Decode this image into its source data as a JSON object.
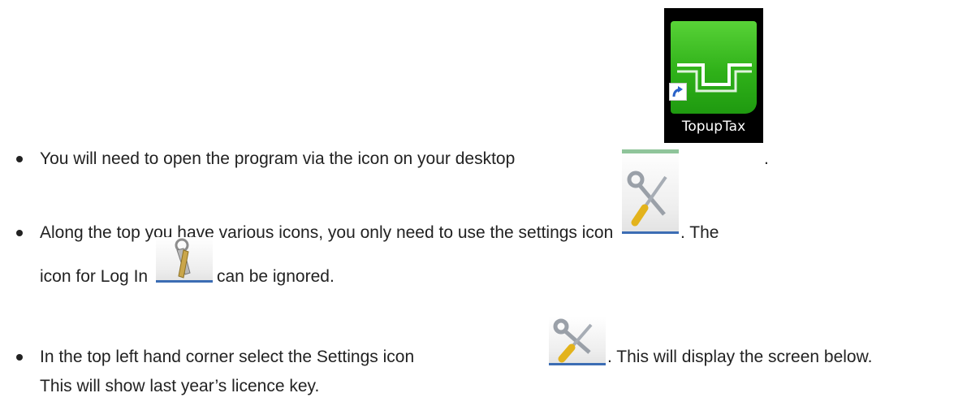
{
  "bullets": [
    {
      "text": "You will need to open the program via the icon on your desktop",
      "trailing": "."
    },
    {
      "text": "Along the top you have various icons, you only need to use the settings icon",
      "trailing": ". The",
      "continuation_before": "icon for Log In",
      "continuation_after": "can be ignored."
    },
    {
      "text": "In the top left hand corner select the Settings icon",
      "trailing": ". This will display the screen below.",
      "continuation": "This will show last year’s licence key."
    }
  ],
  "desktop_icon": {
    "label": "TopupTax",
    "icon": "topuptax-app-icon",
    "tile_color": "#2fb119"
  },
  "icons": {
    "settings": "settings-tools-icon",
    "login": "keys-icon",
    "accent_color": "#3c6db4"
  }
}
